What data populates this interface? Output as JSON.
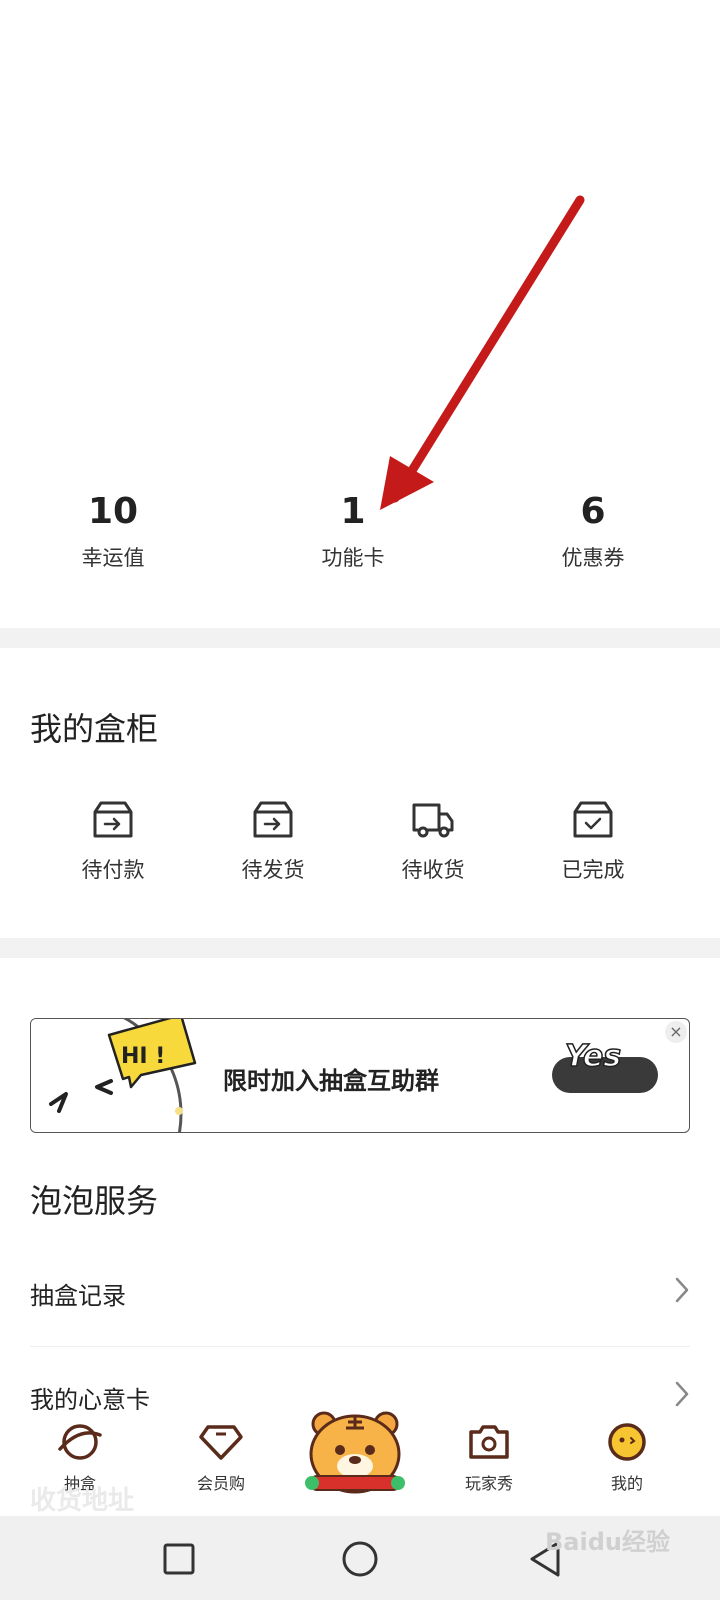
{
  "stats": [
    {
      "value": "10",
      "label": "幸运值"
    },
    {
      "value": "1",
      "label": "功能卡"
    },
    {
      "value": "6",
      "label": "优惠券"
    }
  ],
  "cabinet": {
    "title": "我的盒柜",
    "items": [
      {
        "label": "待付款",
        "icon": "box-arrow-icon"
      },
      {
        "label": "待发货",
        "icon": "box-arrow-icon"
      },
      {
        "label": "待收货",
        "icon": "truck-icon"
      },
      {
        "label": "已完成",
        "icon": "box-check-icon"
      }
    ]
  },
  "banner": {
    "hi": "HI !",
    "text": "限时加入抽盒互助群",
    "yes": "Yes",
    "close": "×"
  },
  "services": {
    "title": "泡泡服务",
    "rows": [
      {
        "label": "抽盒记录"
      },
      {
        "label": "我的心意卡"
      }
    ],
    "faded_text": "收货地址"
  },
  "tabbar": [
    {
      "label": "抽盒",
      "icon": "planet-icon"
    },
    {
      "label": "会员购",
      "icon": "diamond-icon"
    },
    {
      "label": "",
      "icon": "tiger-mascot-icon"
    },
    {
      "label": "玩家秀",
      "icon": "camera-icon"
    },
    {
      "label": "我的",
      "icon": "smiley-icon"
    }
  ],
  "watermark": "Baidu经验",
  "colors": {
    "accent": "#5a2a1a",
    "arrow": "#c41a1a",
    "separator": "#f2f2f2"
  }
}
